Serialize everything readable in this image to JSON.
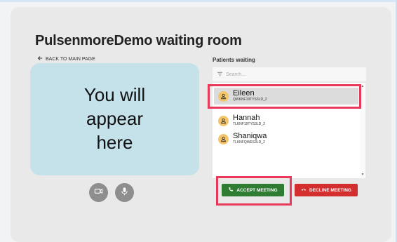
{
  "room": {
    "title": "PulsenmoreDemo waiting room",
    "back_label": "BACK TO MAIN PAGE"
  },
  "video": {
    "placeholder_text": "You will appear here"
  },
  "patients": {
    "label": "Patients waiting",
    "search_placeholder": "Search...",
    "items": [
      {
        "name": "Eileen",
        "id": "QWKNF19TYS3LD_2",
        "selected": true
      },
      {
        "name": "Hannah",
        "id": "TLKNF19TYS3LD_2",
        "selected": false
      },
      {
        "name": "Shaniqwa",
        "id": "TLKNFQWES3LD_2",
        "selected": false
      }
    ]
  },
  "actions": {
    "accept_label": "ACCEPT MEETING",
    "decline_label": "DECLINE MEETING"
  },
  "colors": {
    "accept": "#2e7d32",
    "decline": "#d32f2f",
    "highlight": "#e8395a",
    "avatar": "#f5c56a",
    "video_bg": "#c5e1ea"
  },
  "icons": {
    "camera": "camera-icon",
    "mic": "microphone-icon",
    "back": "arrow-left-icon",
    "search": "filter-lines-icon",
    "avatar": "person-icon",
    "phone": "phone-icon",
    "hangup": "phone-hangup-icon"
  }
}
